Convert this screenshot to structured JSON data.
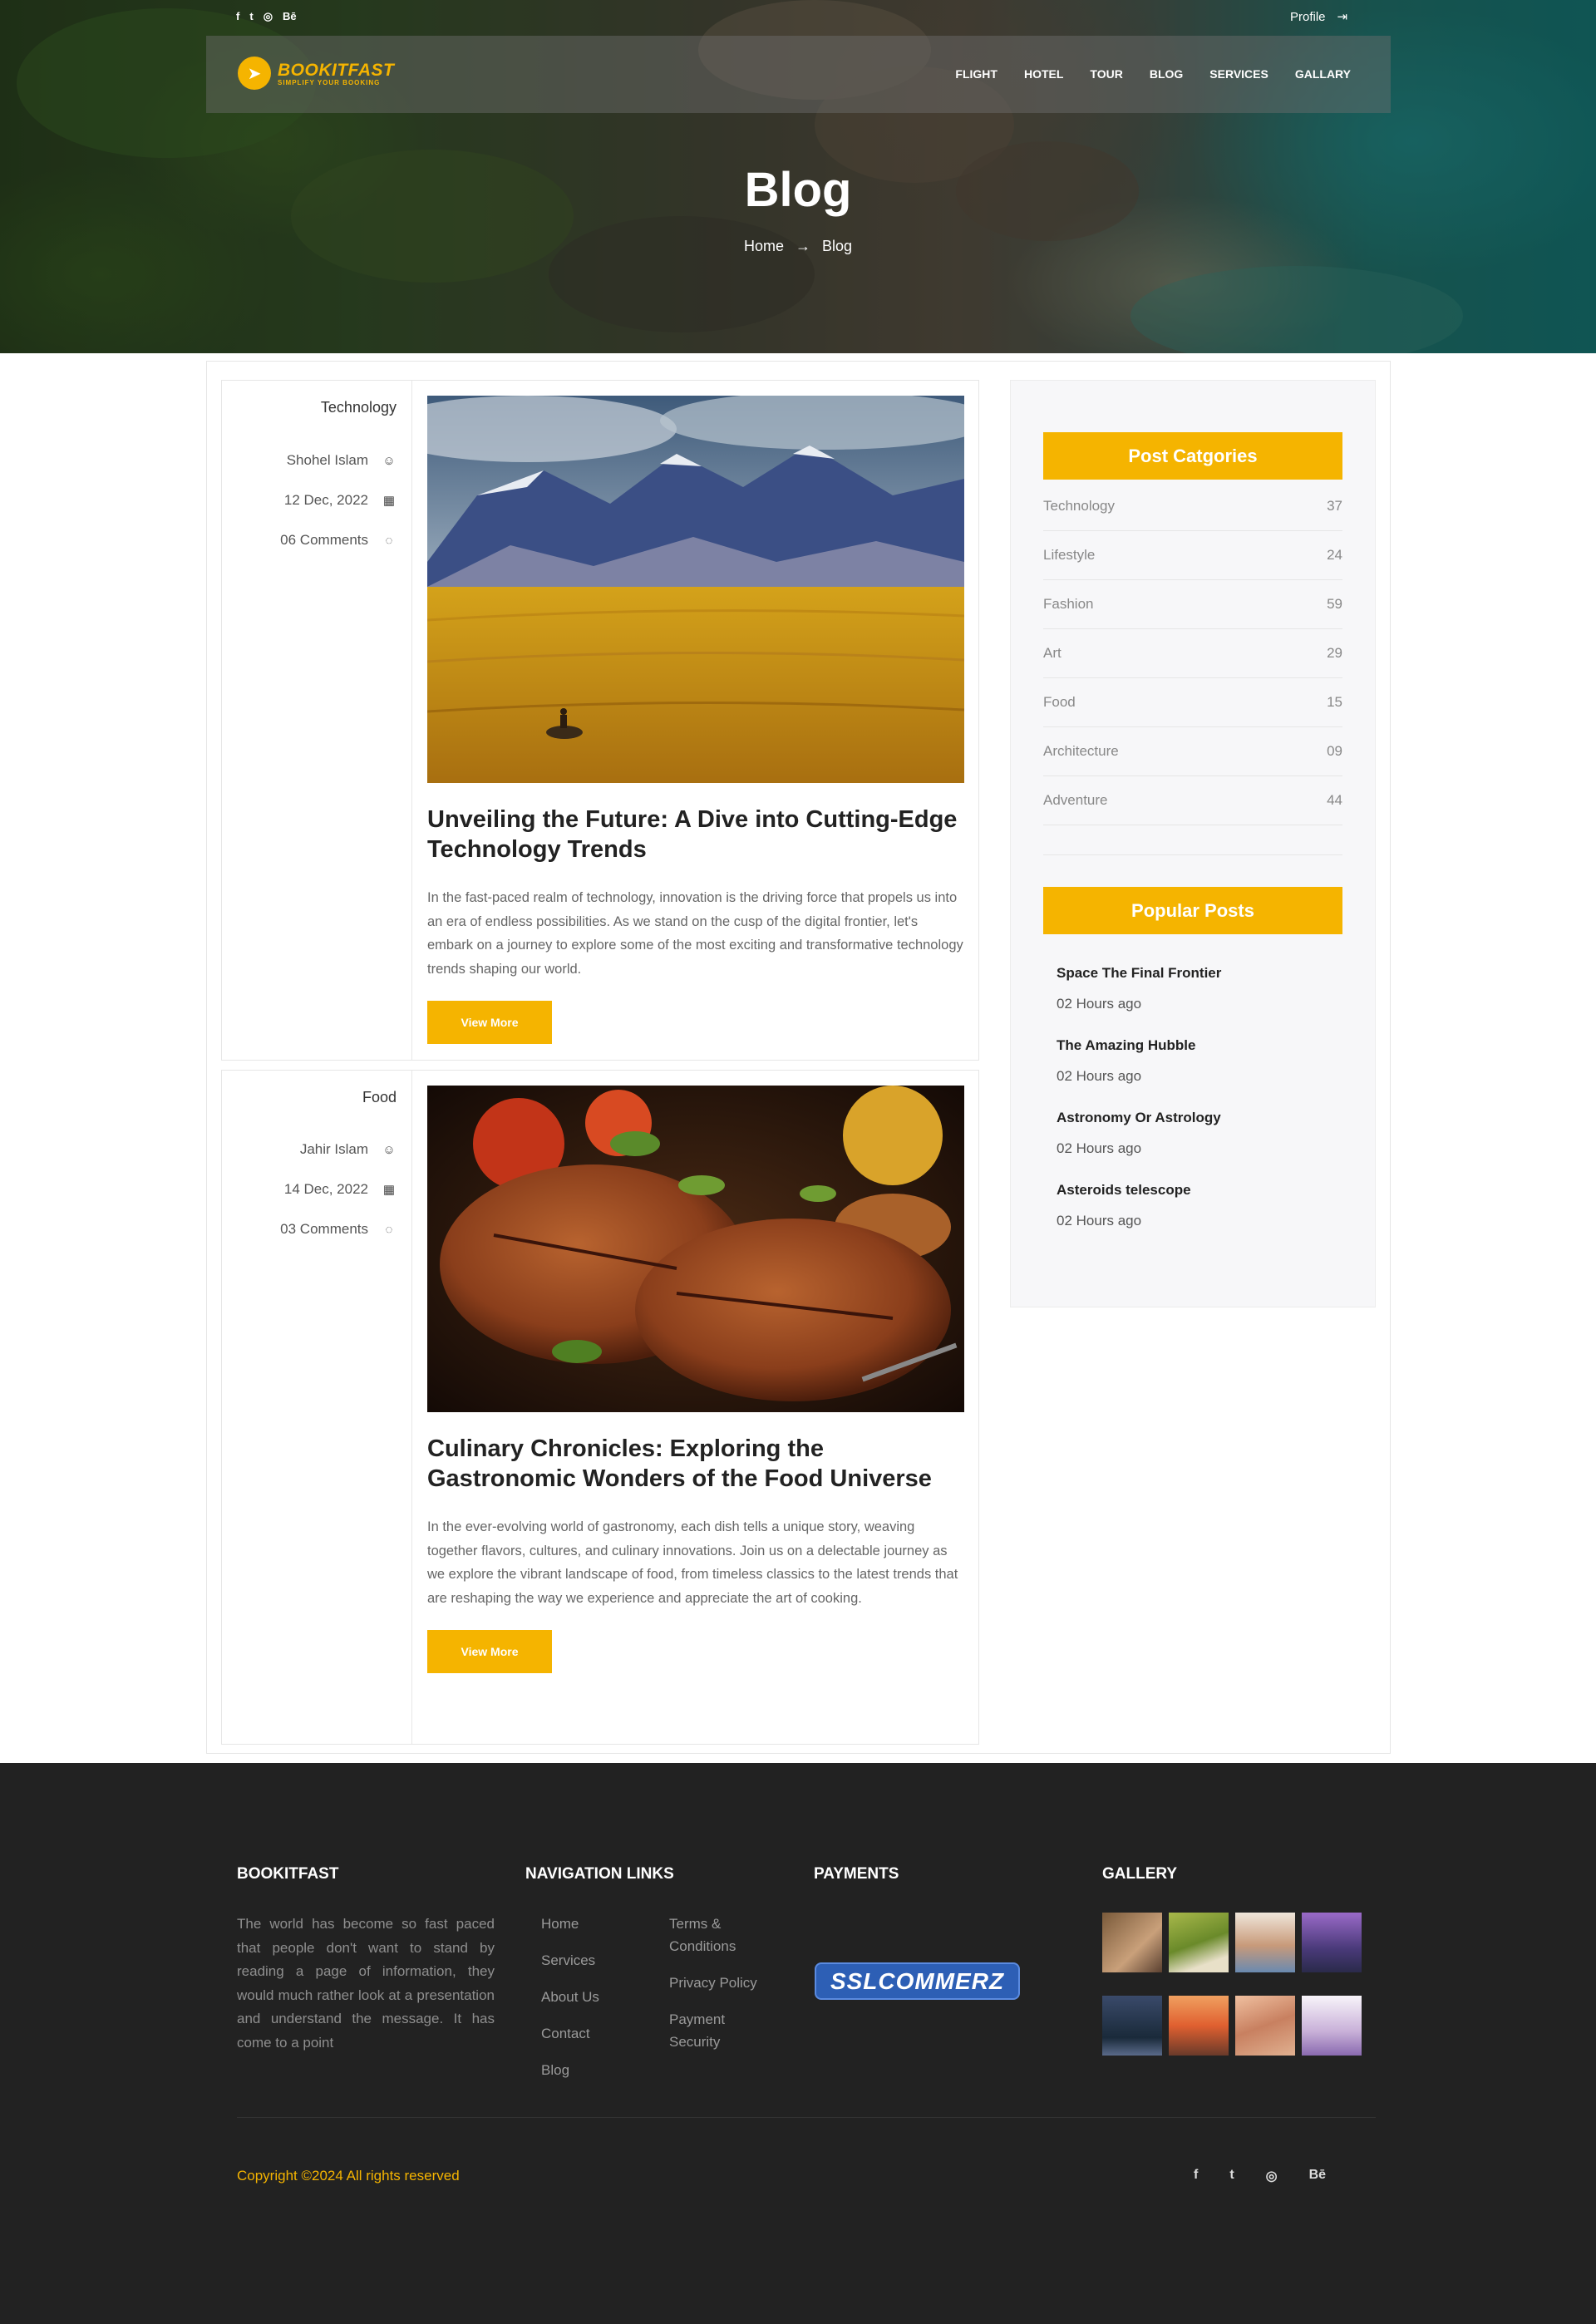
{
  "topbar": {
    "social": [
      "f",
      "t",
      "◎",
      "Bē"
    ],
    "profile_label": "Profile",
    "profile_icon": "⇥"
  },
  "brand": {
    "name": "BOOKITFAST",
    "tagline": "SIMPLIFY YOUR BOOKING",
    "color": "#f5b400"
  },
  "nav": [
    "FLIGHT",
    "HOTEL",
    "TOUR",
    "BLOG",
    "SERVICES",
    "GALLARY"
  ],
  "hero": {
    "title": "Blog",
    "breadcrumb_home": "Home",
    "breadcrumb_arrow": "→",
    "breadcrumb_current": "Blog"
  },
  "posts": [
    {
      "category": "Technology",
      "author": "Shohel Islam",
      "date": "12 Dec, 2022",
      "comments": "06 Comments",
      "image": "mountain-field-horse-rider",
      "title": "Unveiling the Future: A Dive into Cutting-Edge Technology Trends",
      "excerpt": "In the fast-paced realm of technology, innovation is the driving force that propels us into an era of endless possibilities. As we stand on the cusp of the digital frontier, let's embark on a journey to explore some of the most exciting and transformative technology trends shaping our world.",
      "button": "View More"
    },
    {
      "category": "Food",
      "author": "Jahir Islam",
      "date": "14 Dec, 2022",
      "comments": "03 Comments",
      "image": "grilled-steak-vegetables",
      "title": "Culinary Chronicles: Exploring the Gastronomic Wonders of the Food Universe",
      "excerpt": "In the ever-evolving world of gastronomy, each dish tells a unique story, weaving together flavors, cultures, and culinary innovations. Join us on a delectable journey as we explore the vibrant landscape of food, from timeless classics to the latest trends that are reshaping the way we experience and appreciate the art of cooking.",
      "button": "View More"
    }
  ],
  "sidebar": {
    "categories_title": "Post Catgories",
    "categories": [
      {
        "name": "Technology",
        "count": "37"
      },
      {
        "name": "Lifestyle",
        "count": "24"
      },
      {
        "name": "Fashion",
        "count": "59"
      },
      {
        "name": "Art",
        "count": "29"
      },
      {
        "name": "Food",
        "count": "15"
      },
      {
        "name": "Architecture",
        "count": "09"
      },
      {
        "name": "Adventure",
        "count": "44"
      }
    ],
    "popular_title": "Popular Posts",
    "popular": [
      {
        "title": "Space The Final Frontier",
        "time": "02 Hours ago"
      },
      {
        "title": "The Amazing Hubble",
        "time": "02 Hours ago"
      },
      {
        "title": "Astronomy Or Astrology",
        "time": "02 Hours ago"
      },
      {
        "title": "Asteroids telescope",
        "time": "02 Hours ago"
      }
    ]
  },
  "footer": {
    "about_title": "BOOKITFAST",
    "about_text": "The world has become so fast paced that people don't want to stand by reading a page of information, they would much rather look at a presentation and understand the message. It has come to a point",
    "nav_title": "NAVIGATION LINKS",
    "nav_col1": [
      "Home",
      "Services",
      "About Us",
      "Contact",
      "Blog"
    ],
    "nav_col2": [
      "Terms & Conditions",
      "Privacy Policy",
      "Payment Security"
    ],
    "payments_title": "PAYMENTS",
    "payment_logo": "SSLCOMMERZ",
    "gallery_title": "GALLERY",
    "copyright": "Copyright ©2024 All rights reserved",
    "social": [
      "f",
      "t",
      "◎",
      "Bē"
    ]
  }
}
